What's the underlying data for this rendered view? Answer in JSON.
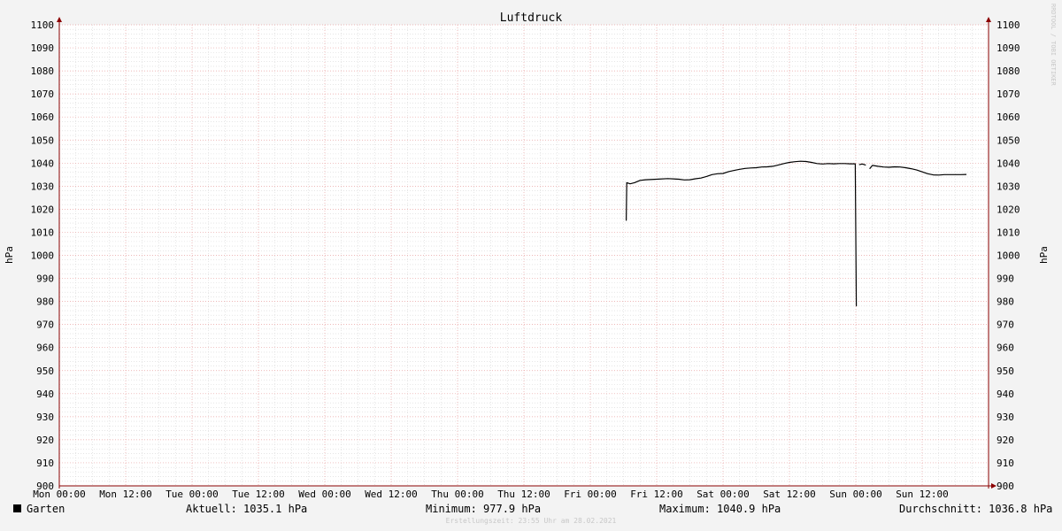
{
  "chart_data": {
    "type": "line",
    "title": "Luftdruck",
    "ylabel_left": "hPa",
    "ylabel_right": "hPa",
    "ylim": [
      900,
      1100
    ],
    "y_ticks": [
      900,
      910,
      920,
      930,
      940,
      950,
      960,
      970,
      980,
      990,
      1000,
      1010,
      1020,
      1030,
      1040,
      1050,
      1060,
      1070,
      1080,
      1090,
      1100
    ],
    "x_ticks": [
      "Mon 00:00",
      "Mon 12:00",
      "Tue 00:00",
      "Tue 12:00",
      "Wed 00:00",
      "Wed 12:00",
      "Thu 00:00",
      "Thu 12:00",
      "Fri 00:00",
      "Fri 12:00",
      "Sat 00:00",
      "Sat 12:00",
      "Sun 00:00",
      "Sun 12:00"
    ],
    "grid": true,
    "series": [
      {
        "name": "Garten",
        "color": "#000000",
        "x_unit": "hours since Mon 00:00",
        "points": [
          [
            102.5,
            1015
          ],
          [
            102.6,
            1031.5
          ],
          [
            103.2,
            1031
          ],
          [
            104,
            1031.5
          ],
          [
            105,
            1032.5
          ],
          [
            106,
            1032.8
          ],
          [
            108,
            1033
          ],
          [
            110,
            1033.3
          ],
          [
            112,
            1033
          ],
          [
            113,
            1032.7
          ],
          [
            114,
            1032.8
          ],
          [
            115,
            1033.2
          ],
          [
            116,
            1033.5
          ],
          [
            117,
            1034.2
          ],
          [
            118,
            1035
          ],
          [
            119,
            1035.4
          ],
          [
            120,
            1035.5
          ],
          [
            121,
            1036.3
          ],
          [
            122,
            1036.8
          ],
          [
            123,
            1037.3
          ],
          [
            124,
            1037.7
          ],
          [
            125,
            1037.9
          ],
          [
            126,
            1038
          ],
          [
            127,
            1038.3
          ],
          [
            128,
            1038.4
          ],
          [
            129,
            1038.6
          ],
          [
            130,
            1039.2
          ],
          [
            131,
            1039.8
          ],
          [
            132,
            1040.3
          ],
          [
            133,
            1040.6
          ],
          [
            134,
            1040.8
          ],
          [
            135,
            1040.7
          ],
          [
            136,
            1040.3
          ],
          [
            137,
            1039.8
          ],
          [
            138,
            1039.6
          ],
          [
            139,
            1039.8
          ],
          [
            140,
            1039.7
          ],
          [
            141,
            1039.8
          ],
          [
            142,
            1039.8
          ],
          [
            143,
            1039.7
          ],
          [
            143.9,
            1039.7
          ],
          [
            144.1,
            977.9
          ],
          null,
          [
            144.6,
            1039.3
          ],
          [
            145.2,
            1039.6
          ],
          [
            145.8,
            1039.1
          ],
          null,
          [
            146.5,
            1037.5
          ],
          [
            147,
            1039
          ],
          [
            148,
            1038.6
          ],
          [
            149,
            1038.3
          ],
          [
            150,
            1038.2
          ],
          [
            151,
            1038.4
          ],
          [
            152,
            1038.3
          ],
          [
            153,
            1038
          ],
          [
            154,
            1037.6
          ],
          [
            155,
            1037
          ],
          [
            156,
            1036.2
          ],
          [
            157,
            1035.4
          ],
          [
            158,
            1034.9
          ],
          [
            159,
            1034.8
          ],
          [
            160,
            1035
          ],
          [
            161,
            1035
          ],
          [
            162,
            1035
          ],
          [
            163,
            1035
          ],
          [
            164,
            1035.1
          ]
        ]
      }
    ],
    "stats": {
      "current": "Aktuell: 1035.1 hPa",
      "minimum": "Minimum: 977.9 hPa",
      "maximum": "Maximum: 1040.9 hPa",
      "average": "Durchschnitt: 1036.8 hPa"
    },
    "footer": "Erstellungszeit: 23:55 Uhr am 28.02.2021",
    "watermark": "RRDTOOL / TOBI OETIKER",
    "colors": {
      "background": "#f3f3f3",
      "plot": "#ffffff",
      "major_grid": "#e8a0a0",
      "minor_grid": "#d6d6d6",
      "axis": "#8b0000",
      "line": "#000000"
    }
  }
}
